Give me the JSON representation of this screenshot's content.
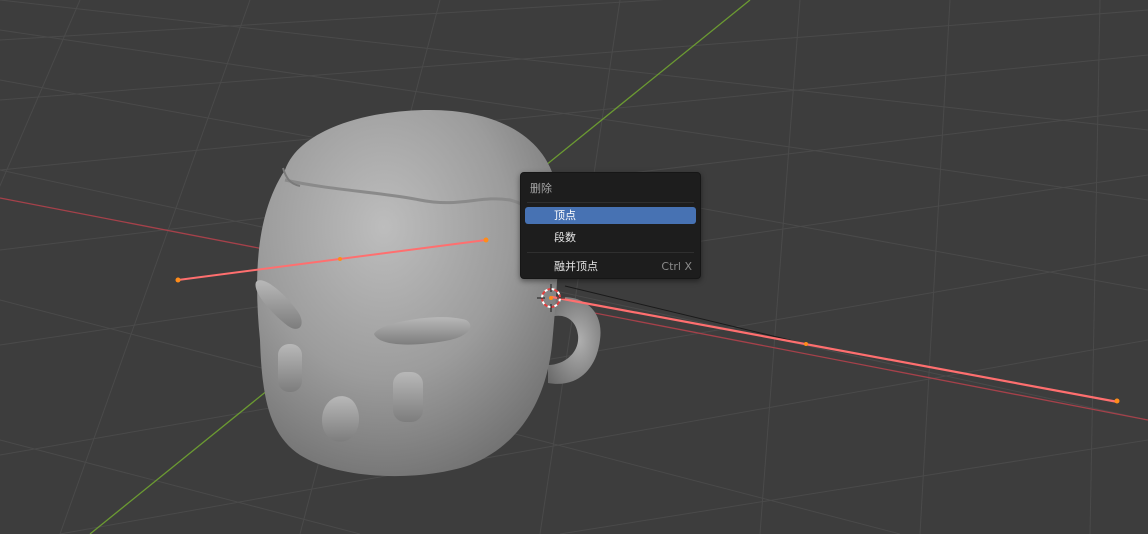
{
  "viewport": {
    "background": "#3d3d3d",
    "grid_color": "#4a4a4a",
    "x_axis_color": "#a5414a",
    "y_axis_color": "#6b9a32",
    "mesh_color": "#a3a3a3",
    "curve_color": "#ff6f6f",
    "control_point_color": "#ff8c1a"
  },
  "context_menu": {
    "title": "删除",
    "items": [
      {
        "label": "顶点",
        "shortcut": "",
        "active": true
      },
      {
        "label": "段数",
        "shortcut": "",
        "active": false
      },
      {
        "label": "融并顶点",
        "shortcut": "Ctrl X",
        "active": false
      }
    ]
  }
}
